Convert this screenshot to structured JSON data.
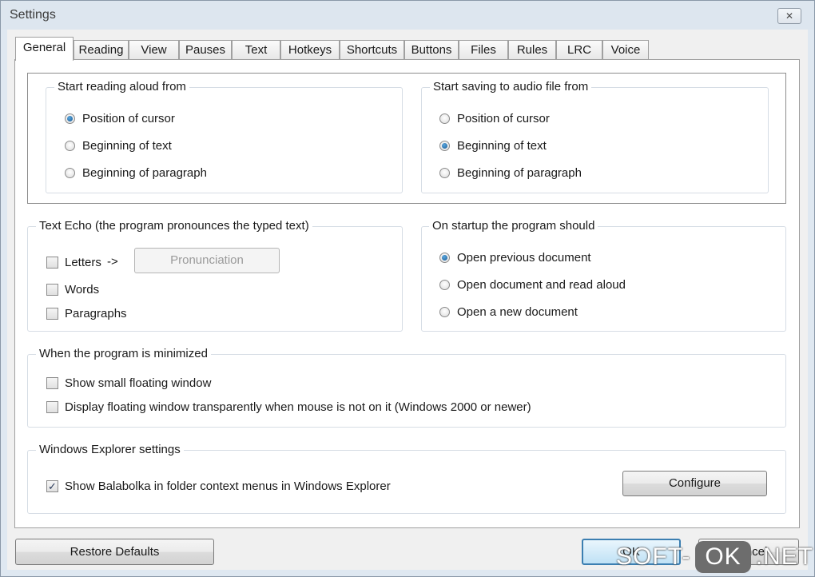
{
  "window": {
    "title": "Settings",
    "close_glyph": "✕"
  },
  "tabs": [
    {
      "label": "General",
      "active": true
    },
    {
      "label": "Reading"
    },
    {
      "label": "View"
    },
    {
      "label": "Pauses"
    },
    {
      "label": "Text"
    },
    {
      "label": "Hotkeys"
    },
    {
      "label": "Shortcuts"
    },
    {
      "label": "Buttons"
    },
    {
      "label": "Files"
    },
    {
      "label": "Rules"
    },
    {
      "label": "LRC"
    },
    {
      "label": "Voice"
    }
  ],
  "start_reading": {
    "legend": "Start reading aloud from",
    "options": [
      "Position of cursor",
      "Beginning of text",
      "Beginning of paragraph"
    ],
    "selected": 0
  },
  "start_saving": {
    "legend": "Start saving to audio file from",
    "options": [
      "Position of cursor",
      "Beginning of text",
      "Beginning of paragraph"
    ],
    "selected": 1
  },
  "text_echo": {
    "legend": "Text Echo (the program pronounces the typed text)",
    "letters": "Letters",
    "arrow": "->",
    "words": "Words",
    "paragraphs": "Paragraphs",
    "pronunciation_button": "Pronunciation"
  },
  "startup": {
    "legend": "On startup the program should",
    "options": [
      "Open previous document",
      "Open document and read aloud",
      "Open a new document"
    ],
    "selected": 0
  },
  "minimized": {
    "legend": "When the program is minimized",
    "show_floating": "Show small floating window",
    "transparent": "Display floating window transparently when mouse is not on it (Windows 2000 or newer)"
  },
  "explorer": {
    "legend": "Windows Explorer settings",
    "context_menus": "Show Balabolka in folder context menus in Windows Explorer",
    "context_menus_checked": true,
    "check_glyph": "✓",
    "configure_button": "Configure"
  },
  "footer": {
    "restore_defaults": "Restore Defaults",
    "ok": "OK",
    "cancel": "Cancel"
  },
  "watermark": {
    "left": "SOFT-",
    "box": "OK",
    "right": ".NET"
  }
}
